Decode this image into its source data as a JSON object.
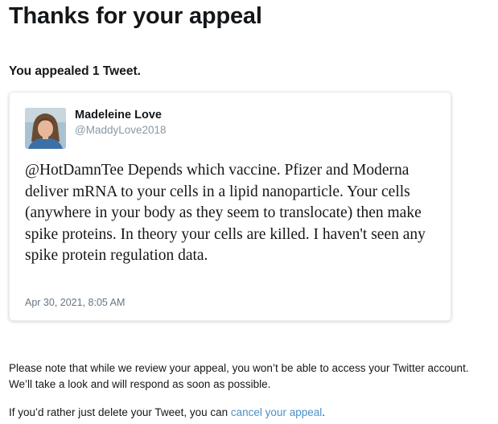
{
  "page": {
    "title": "Thanks for your appeal",
    "summary": "You appealed 1 Tweet."
  },
  "tweet": {
    "author_name": "Madeleine Love",
    "author_handle": "@MaddyLove2018",
    "avatar_icon": "profile-photo",
    "text": "@HotDamnTee Depends which vaccine. Pfizer and Moderna deliver mRNA to your cells in a lipid nanoparticle. Your cells (anywhere in your body as they seem to translocate) then make spike proteins. In theory your cells are killed. I haven't seen any spike protein regulation data.",
    "timestamp": "Apr 30, 2021, 8:05 AM"
  },
  "notice": {
    "text": "Please note that while we review your appeal, you won’t be able to access your Twitter account. We’ll take a look and will respond as soon as possible.",
    "cancel_prefix": "If you’d rather just delete your Tweet, you can ",
    "cancel_link": "cancel your appeal",
    "cancel_suffix": "."
  },
  "colors": {
    "text_primary": "#14171a",
    "text_secondary": "#8899a6",
    "link": "#4a90c9",
    "card_border": "#e6ecf0"
  }
}
